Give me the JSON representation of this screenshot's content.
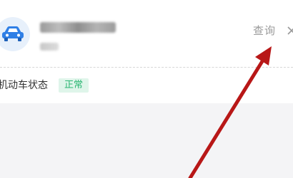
{
  "vehicle": {
    "icon": "car-icon",
    "plate_blurred": true
  },
  "header": {
    "query_label": "查询",
    "close_icon": "close-icon"
  },
  "status": {
    "label": "机动车状态",
    "badge": "正常",
    "badge_color": "#2bb673",
    "badge_bg": "#dff5ea"
  },
  "annotation": {
    "icon": "arrow-icon",
    "color": "#b81717"
  }
}
